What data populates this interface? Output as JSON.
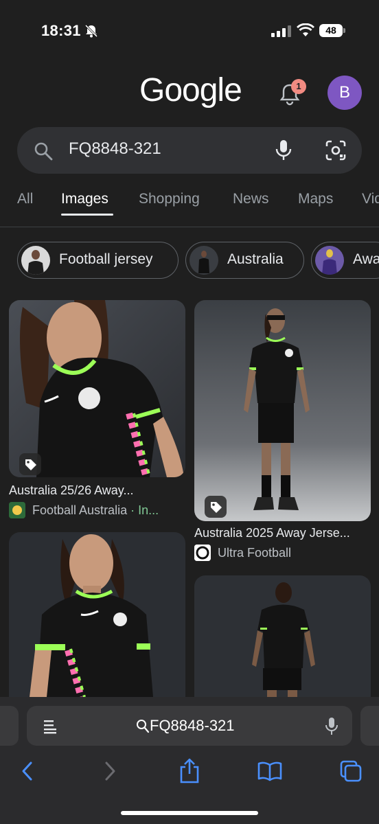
{
  "status": {
    "time": "18:31",
    "battery": "48"
  },
  "header": {
    "logo": "Google",
    "notification_count": "1",
    "avatar_letter": "B"
  },
  "search": {
    "query": "FQ8848-321"
  },
  "tabs": [
    {
      "label": "All"
    },
    {
      "label": "Images"
    },
    {
      "label": "Shopping"
    },
    {
      "label": "News"
    },
    {
      "label": "Maps"
    },
    {
      "label": "Vid"
    }
  ],
  "chips": [
    {
      "label": "Football jersey"
    },
    {
      "label": "Australia"
    },
    {
      "label": "Awa"
    }
  ],
  "results": [
    {
      "title": "Australia 25/26 Away...",
      "source": "Football Australia",
      "extra": " · In..."
    },
    {
      "title": "Australia 2025 Away Jerse...",
      "source": "Ultra Football"
    }
  ],
  "address_bar": {
    "text": "FQ8848-321"
  },
  "colors": {
    "background": "#1f1f1f",
    "accent_green": "#9cff57",
    "avatar": "#7e57c2",
    "badge": "#f28b82"
  }
}
